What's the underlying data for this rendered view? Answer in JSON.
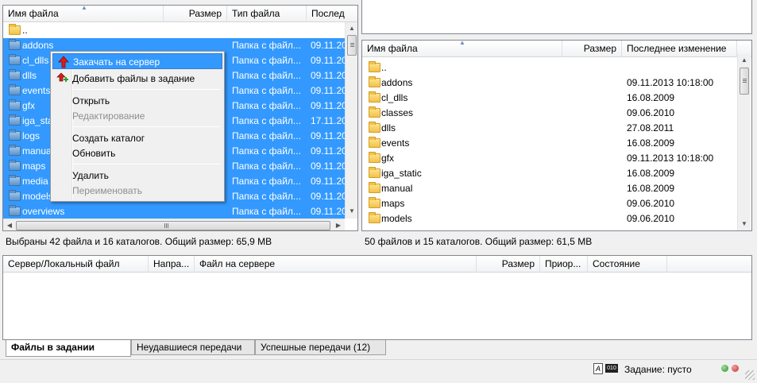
{
  "local": {
    "headers": {
      "name": "Имя файла",
      "size": "Размер",
      "type": "Тип файла",
      "modified": "Послед"
    },
    "rows": [
      {
        "name": "..",
        "type": "",
        "date": "",
        "selected": false
      },
      {
        "name": "addons",
        "type": "Папка с файл...",
        "date": "09.11.20",
        "selected": true
      },
      {
        "name": "cl_dlls",
        "type": "Папка с файл...",
        "date": "09.11.20",
        "selected": true
      },
      {
        "name": "dlls",
        "type": "Папка с файл...",
        "date": "09.11.20",
        "selected": true
      },
      {
        "name": "events",
        "type": "Папка с файл...",
        "date": "09.11.20",
        "selected": true
      },
      {
        "name": "gfx",
        "type": "Папка с файл...",
        "date": "09.11.20",
        "selected": true
      },
      {
        "name": "iga_static",
        "type": "Папка с файл...",
        "date": "17.11.20",
        "selected": true
      },
      {
        "name": "logs",
        "type": "Папка с файл...",
        "date": "09.11.20",
        "selected": true
      },
      {
        "name": "manual",
        "type": "Папка с файл...",
        "date": "09.11.20",
        "selected": true
      },
      {
        "name": "maps",
        "type": "Папка с файл...",
        "date": "09.11.20",
        "selected": true
      },
      {
        "name": "media",
        "type": "Папка с файл...",
        "date": "09.11.20",
        "selected": true
      },
      {
        "name": "models",
        "type": "Папка с файл...",
        "date": "09.11.20",
        "selected": true
      },
      {
        "name": "overviews",
        "type": "Папка с файл...",
        "date": "09.11.20",
        "selected": true
      }
    ],
    "status": "Выбраны 42 файла и 16 каталогов. Общий размер: 65,9 МВ"
  },
  "context_menu": {
    "items": [
      {
        "label": "Закачать на сервер",
        "icon": "upload-arrow-icon",
        "highlighted": true,
        "disabled": false
      },
      {
        "label": "Добавить файлы в задание",
        "icon": "add-to-queue-icon",
        "highlighted": false,
        "disabled": false
      },
      {
        "label": "Открыть",
        "disabled": false
      },
      {
        "label": "Редактирование",
        "disabled": true
      },
      {
        "label": "Создать каталог",
        "disabled": false
      },
      {
        "label": "Обновить",
        "disabled": false
      },
      {
        "label": "Удалить",
        "disabled": false
      },
      {
        "label": "Переименовать",
        "disabled": true
      }
    ]
  },
  "remote": {
    "headers": {
      "name": "Имя файла",
      "size": "Размер",
      "modified": "Последнее изменение"
    },
    "rows": [
      {
        "name": "..",
        "date": ""
      },
      {
        "name": "addons",
        "date": "09.11.2013 10:18:00"
      },
      {
        "name": "cl_dlls",
        "date": "16.08.2009"
      },
      {
        "name": "classes",
        "date": "09.06.2010"
      },
      {
        "name": "dlls",
        "date": "27.08.2011"
      },
      {
        "name": "events",
        "date": "16.08.2009"
      },
      {
        "name": "gfx",
        "date": "09.11.2013 10:18:00"
      },
      {
        "name": "iga_static",
        "date": "16.08.2009"
      },
      {
        "name": "manual",
        "date": "16.08.2009"
      },
      {
        "name": "maps",
        "date": "09.06.2010"
      },
      {
        "name": "models",
        "date": "09.06.2010"
      }
    ],
    "status": "50 файлов и 15 каталогов. Общий размер: 61,5 МВ"
  },
  "queue": {
    "headers": {
      "server_local": "Сервер/Локальный файл",
      "direction": "Напра...",
      "remote_file": "Файл на сервере",
      "size": "Размер",
      "priority": "Приор...",
      "state": "Состояние"
    }
  },
  "tabs": [
    {
      "label": "Файлы в задании",
      "active": true
    },
    {
      "label": "Неудавшиеся передачи",
      "active": false
    },
    {
      "label": "Успешные передачи (12)",
      "active": false
    }
  ],
  "statusbar": {
    "queue_text": "Задание: пусто",
    "binary_label": "010"
  },
  "colors": {
    "selection": "#3399ff",
    "led_green": "#2e8b2e",
    "led_red": "#c0302a"
  }
}
